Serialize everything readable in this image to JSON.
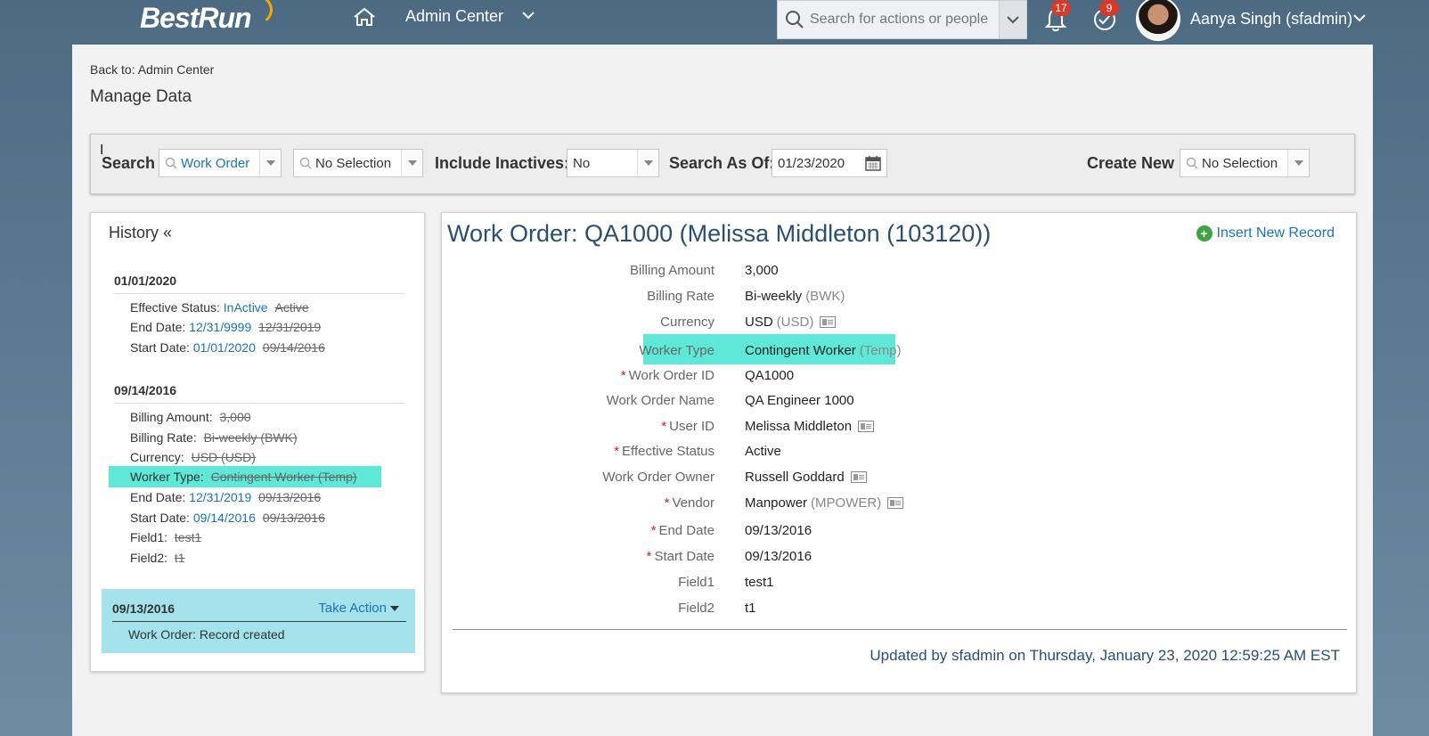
{
  "header": {
    "logo": "BestRun",
    "module": "Admin Center",
    "search_placeholder": "Search for actions or people",
    "notifications_count": "17",
    "tasks_count": "9",
    "user_name": "Aanya Singh (sfadmin)"
  },
  "page": {
    "back_link": "Back to: Admin Center",
    "title": "Manage Data"
  },
  "search_bar": {
    "search_label": "Search",
    "object_type": "Work Order",
    "record_selection": "No Selection",
    "include_inactives_label": "Include Inactives:",
    "include_inactives_value": "No",
    "search_as_of_label": "Search As Of:",
    "search_as_of_value": "01/23/2020",
    "create_new_label": "Create New",
    "create_new_value": "No Selection"
  },
  "history": {
    "title": "History «",
    "groups": [
      {
        "date": "01/01/2020",
        "lines": [
          {
            "label": "Effective Status:",
            "new": "InActive",
            "old": "Active"
          },
          {
            "label": "End Date:",
            "new": "12/31/9999",
            "old": "12/31/2019"
          },
          {
            "label": "Start Date:",
            "new": "01/01/2020",
            "old": "09/14/2016"
          }
        ]
      },
      {
        "date": "09/14/2016",
        "lines": [
          {
            "label": "Billing Amount:",
            "new": "",
            "old": "3,000"
          },
          {
            "label": "Billing Rate:",
            "new": "",
            "old": "Bi-weekly (BWK)"
          },
          {
            "label": "Currency:",
            "new": "",
            "old": "USD (USD)"
          },
          {
            "label": "Worker Type:",
            "new": "",
            "old": "Contingent Worker (Temp)"
          },
          {
            "label": "End Date:",
            "new": "12/31/2019",
            "old": "09/13/2016"
          },
          {
            "label": "Start Date:",
            "new": "09/14/2016",
            "old": "09/13/2016"
          },
          {
            "label": "Field1:",
            "new": "",
            "old": "test1"
          },
          {
            "label": "Field2:",
            "new": "",
            "old": "t1"
          }
        ]
      }
    ],
    "current": {
      "date": "09/13/2016",
      "action": "Take Action",
      "text": "Work Order: Record created"
    }
  },
  "detail": {
    "title": "Work Order: QA1000 (Melissa Middleton (103120))",
    "insert_new": "Insert New Record",
    "fields": [
      {
        "label": "Billing Amount",
        "value": "3,000",
        "code": ""
      },
      {
        "label": "Billing Rate",
        "value": "Bi-weekly",
        "code": "(BWK)"
      },
      {
        "label": "Currency",
        "value": "USD",
        "code": "(USD)"
      },
      {
        "label": "Worker Type",
        "value": "Contingent Worker",
        "code": "(Temp)"
      },
      {
        "label": "Work Order ID",
        "value": "QA1000",
        "code": ""
      },
      {
        "label": "Work Order Name",
        "value": "QA Engineer 1000",
        "code": ""
      },
      {
        "label": "User ID",
        "value": "Melissa Middleton",
        "code": ""
      },
      {
        "label": "Effective Status",
        "value": "Active",
        "code": ""
      },
      {
        "label": "Work Order Owner",
        "value": "Russell Goddard",
        "code": ""
      },
      {
        "label": "Vendor",
        "value": "Manpower",
        "code": "(MPOWER)"
      },
      {
        "label": "End Date",
        "value": "09/13/2016",
        "code": ""
      },
      {
        "label": "Start Date",
        "value": "09/13/2016",
        "code": ""
      },
      {
        "label": "Field1",
        "value": "test1",
        "code": ""
      },
      {
        "label": "Field2",
        "value": "t1",
        "code": ""
      }
    ],
    "updated": "Updated by sfadmin on Thursday, January 23, 2020 12:59:25 AM EST"
  },
  "colors": {
    "link": "#1a73b8",
    "highlight": "#5ee8d8",
    "current_history": "#a4e2ec",
    "required": "#d0271d",
    "badge": "#d63a2a",
    "title": "#2a4f6f"
  }
}
